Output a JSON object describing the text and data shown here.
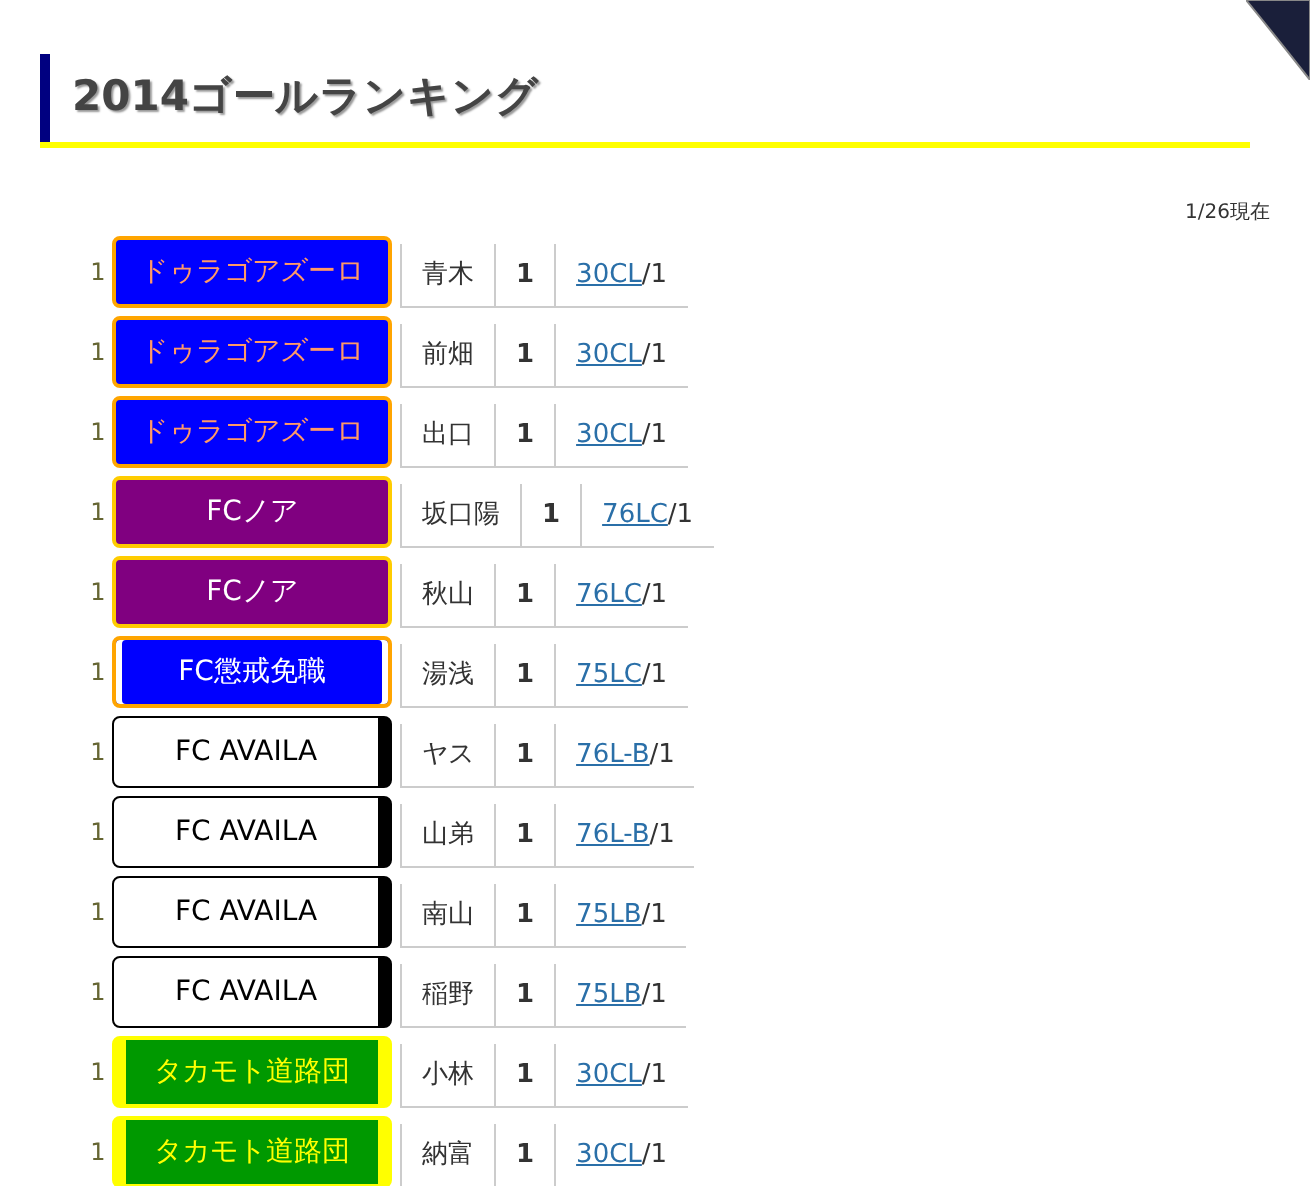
{
  "title": "2014ゴールランキング",
  "as_of": "1/26現在",
  "rows": [
    {
      "rank": "1",
      "team": {
        "name": "ドゥラゴアズーロ",
        "kind": "orange_rim",
        "color": "#0000ff"
      },
      "player": "青木",
      "goals": "1",
      "link": "30CL",
      "suffix": "/1"
    },
    {
      "rank": "1",
      "team": {
        "name": "ドゥラゴアズーロ",
        "kind": "orange_rim",
        "color": "#0000ff"
      },
      "player": "前畑",
      "goals": "1",
      "link": "30CL",
      "suffix": "/1"
    },
    {
      "rank": "1",
      "team": {
        "name": "ドゥラゴアズーロ",
        "kind": "orange_rim",
        "color": "#0000ff"
      },
      "player": "出口",
      "goals": "1",
      "link": "30CL",
      "suffix": "/1"
    },
    {
      "rank": "1",
      "team": {
        "name": "FCノア",
        "kind": "gold_rim",
        "color": "#800080"
      },
      "player": "坂口陽",
      "goals": "1",
      "link": "76LC",
      "suffix": "/1"
    },
    {
      "rank": "1",
      "team": {
        "name": "FCノア",
        "kind": "gold_rim",
        "color": "#800080"
      },
      "player": "秋山",
      "goals": "1",
      "link": "76LC",
      "suffix": "/1"
    },
    {
      "rank": "1",
      "team": {
        "name": "FC懲戒免職",
        "kind": "inner_lines",
        "color": "#0000ff"
      },
      "player": "湯浅",
      "goals": "1",
      "link": "75LC",
      "suffix": "/1"
    },
    {
      "rank": "1",
      "team": {
        "name": "FC AVAILA",
        "kind": "right_bar",
        "color": "#ffffff"
      },
      "player": "ヤス",
      "goals": "1",
      "link": "76L-B",
      "suffix": "/1"
    },
    {
      "rank": "1",
      "team": {
        "name": "FC AVAILA",
        "kind": "right_bar",
        "color": "#ffffff"
      },
      "player": "山弟",
      "goals": "1",
      "link": "76L-B",
      "suffix": "/1"
    },
    {
      "rank": "1",
      "team": {
        "name": "FC AVAILA",
        "kind": "right_bar",
        "color": "#ffffff"
      },
      "player": "南山",
      "goals": "1",
      "link": "75LB",
      "suffix": "/1"
    },
    {
      "rank": "1",
      "team": {
        "name": "FC AVAILA",
        "kind": "right_bar",
        "color": "#ffffff"
      },
      "player": "稲野",
      "goals": "1",
      "link": "75LB",
      "suffix": "/1"
    },
    {
      "rank": "1",
      "team": {
        "name": "タカモト道路団",
        "kind": "side_bars",
        "color": "#009900"
      },
      "player": "小林",
      "goals": "1",
      "link": "30CL",
      "suffix": "/1"
    },
    {
      "rank": "1",
      "team": {
        "name": "タカモト道路団",
        "kind": "side_bars",
        "color": "#009900"
      },
      "player": "納富",
      "goals": "1",
      "link": "30CL",
      "suffix": "/1"
    }
  ]
}
